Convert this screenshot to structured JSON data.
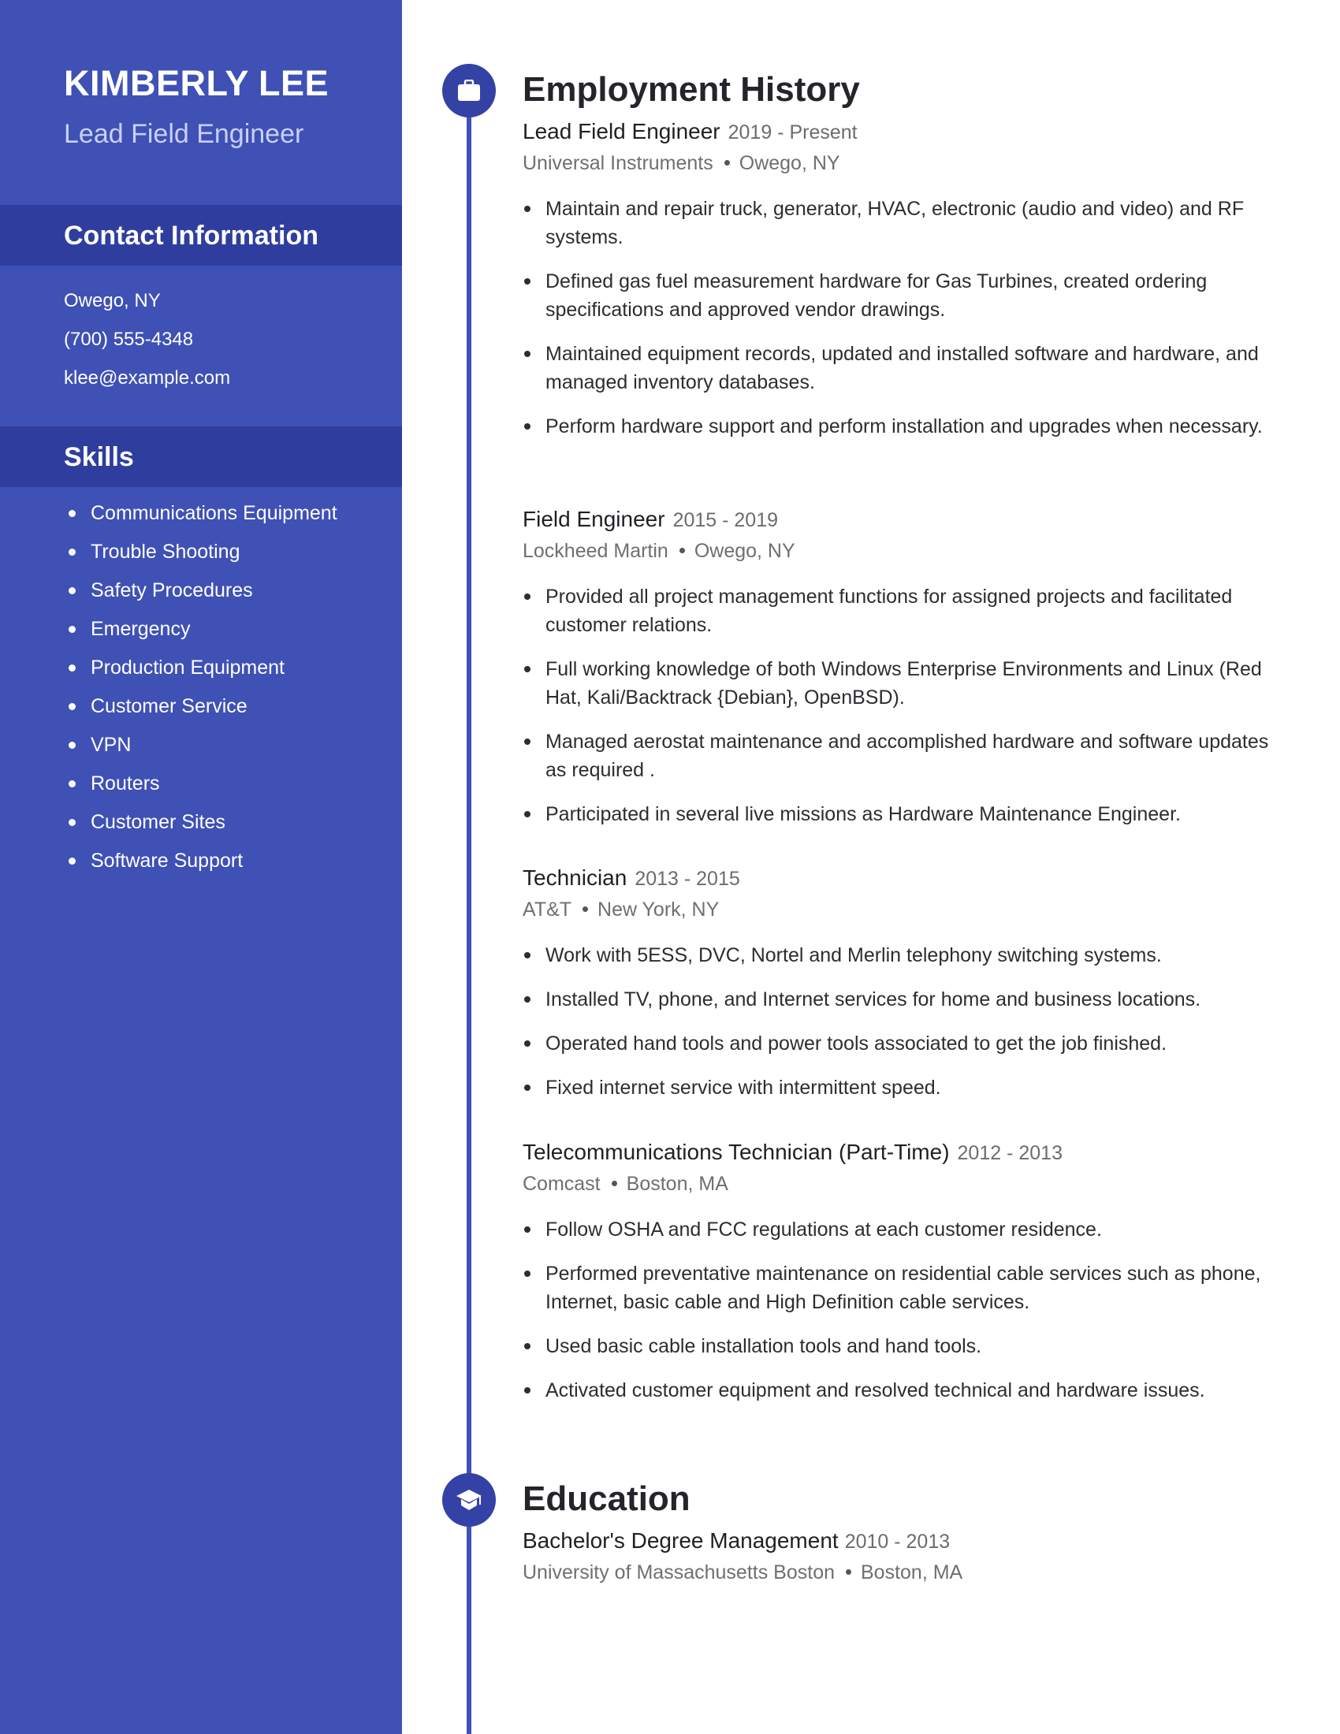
{
  "profile": {
    "name": "KIMBERLY LEE",
    "title": "Lead Field Engineer"
  },
  "contact": {
    "heading": "Contact Information",
    "items": [
      "Owego, NY",
      "(700) 555-4348",
      "klee@example.com"
    ]
  },
  "skills": {
    "heading": "Skills",
    "items": [
      "Communications Equipment",
      "Trouble Shooting",
      "Safety Procedures",
      "Emergency",
      "Production Equipment",
      "Customer Service",
      "VPN",
      "Routers",
      "Customer Sites",
      "Software Support"
    ]
  },
  "employment": {
    "heading": "Employment History",
    "icon": "briefcase-icon",
    "jobs": [
      {
        "title": "Lead Field Engineer",
        "dates": "2019 - Present",
        "company": "Universal Instruments",
        "location": "Owego, NY",
        "bullets": [
          "Maintain and repair truck, generator, HVAC, electronic (audio and video) and RF systems.",
          "Defined gas fuel measurement hardware for Gas Turbines, created ordering specifications and approved vendor drawings.",
          "Maintained equipment records, updated and installed software and hardware, and managed inventory databases.",
          "Perform hardware support and perform installation and upgrades when necessary."
        ]
      },
      {
        "title": "Field Engineer",
        "dates": "2015 - 2019",
        "company": "Lockheed Martin",
        "location": "Owego, NY",
        "bullets": [
          "Provided all project management functions for assigned projects and facilitated customer relations.",
          "Full working knowledge of both Windows Enterprise Environments and Linux (Red Hat, Kali/Backtrack {Debian}, OpenBSD).",
          "Managed aerostat maintenance and accomplished hardware and software updates as required .",
          "Participated in several live missions as Hardware Maintenance Engineer."
        ]
      },
      {
        "title": "Technician",
        "dates": "2013 - 2015",
        "company": "AT&T",
        "location": "New York, NY",
        "bullets": [
          "Work with 5ESS, DVC, Nortel and Merlin telephony switching systems.",
          "Installed TV, phone, and Internet services for home and business locations.",
          "Operated hand tools and power tools associated to get the job finished.",
          "Fixed internet service with intermittent speed."
        ]
      },
      {
        "title": "Telecommunications Technician (Part-Time)",
        "dates": "2012 - 2013",
        "company": "Comcast",
        "location": "Boston, MA",
        "bullets": [
          "Follow OSHA and FCC regulations at each customer residence.",
          "Performed preventative maintenance on residential cable services such as phone, Internet, basic cable and High Definition cable services.",
          "Used basic cable installation tools and hand tools.",
          "Activated customer equipment and resolved technical and hardware issues."
        ]
      }
    ]
  },
  "education": {
    "heading": "Education",
    "icon": "graduation-cap-icon",
    "entries": [
      {
        "degree": "Bachelor's Degree Management",
        "dates": "2010 - 2013",
        "school": "University of Massachusetts Boston",
        "location": "Boston, MA"
      }
    ]
  },
  "colors": {
    "sidebar": "#3f51b5",
    "sidebar_band": "#2f3e9e",
    "accent": "#3f51b5",
    "icon_circle": "#3442a6",
    "subtitle": "#c9cff5"
  }
}
